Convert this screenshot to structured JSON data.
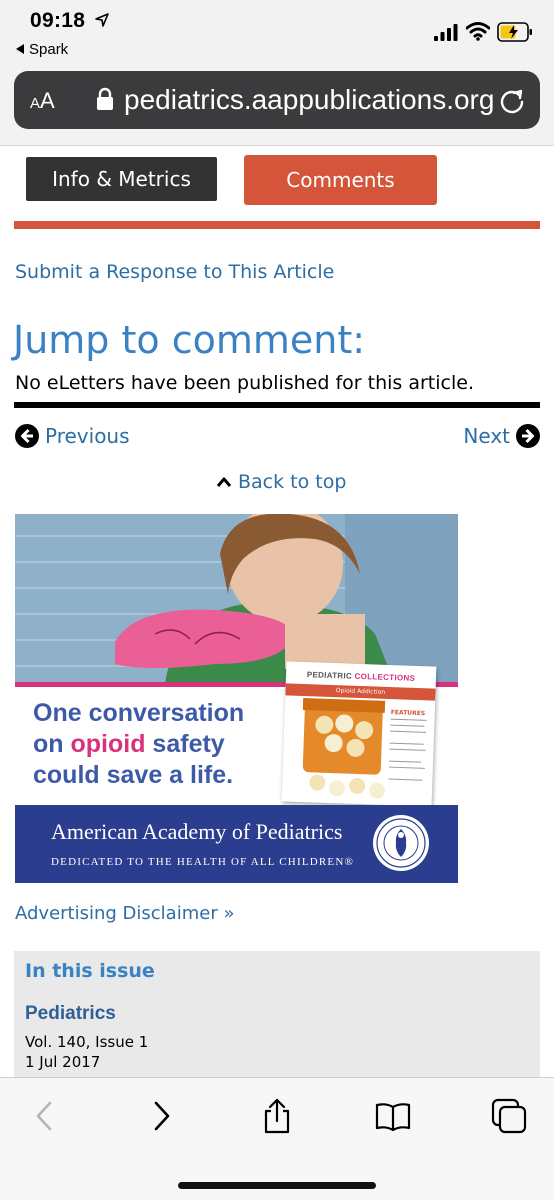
{
  "status_bar": {
    "time": "09:18",
    "back_app": "Spark",
    "icons": [
      "location-arrow-icon",
      "signal-icon",
      "wifi-icon",
      "battery-charging-icon"
    ]
  },
  "browser": {
    "text_size_label": "AA",
    "url": "pediatrics.aappublications.org",
    "icons": [
      "lock-icon",
      "reload-icon"
    ]
  },
  "tabs": {
    "info": "Info & Metrics",
    "comments": "Comments",
    "active": "Comments",
    "active_color": "#d4553a"
  },
  "content": {
    "submit_link": "Submit a Response to This Article",
    "jump_heading": "Jump to comment:",
    "no_letters": "No eLetters have been published for this article.",
    "previous": "Previous",
    "next": "Next",
    "back_to_top": "Back to top",
    "link_color": "#2e6da4"
  },
  "ad": {
    "headline_1": "One conversation",
    "headline_2_pre": "on ",
    "headline_2_hl": "opioid",
    "headline_2_post": " safety",
    "headline_3": "could save a life.",
    "cover_title_1": "PEDIATRIC ",
    "cover_title_2": "COLLECTIONS",
    "cover_subtitle": "Opioid Addiction",
    "cover_features": "FEATURES",
    "org_name": "American Academy of Pediatrics",
    "org_tagline": "DEDICATED TO THE HEALTH OF ALL CHILDREN®",
    "disclaimer": "Advertising Disclaimer »",
    "colors": {
      "pink": "#d6327e",
      "blue": "#3d5aa8",
      "footer": "#2b3d8f"
    }
  },
  "issue": {
    "heading": "In this issue",
    "journal": "Pediatrics",
    "volume": "Vol. 140, Issue 1",
    "date": "1 Jul 2017"
  },
  "toolbar": {
    "icons": [
      "back-arrow-icon",
      "forward-arrow-icon",
      "share-icon",
      "bookmarks-icon",
      "tabs-icon"
    ]
  }
}
